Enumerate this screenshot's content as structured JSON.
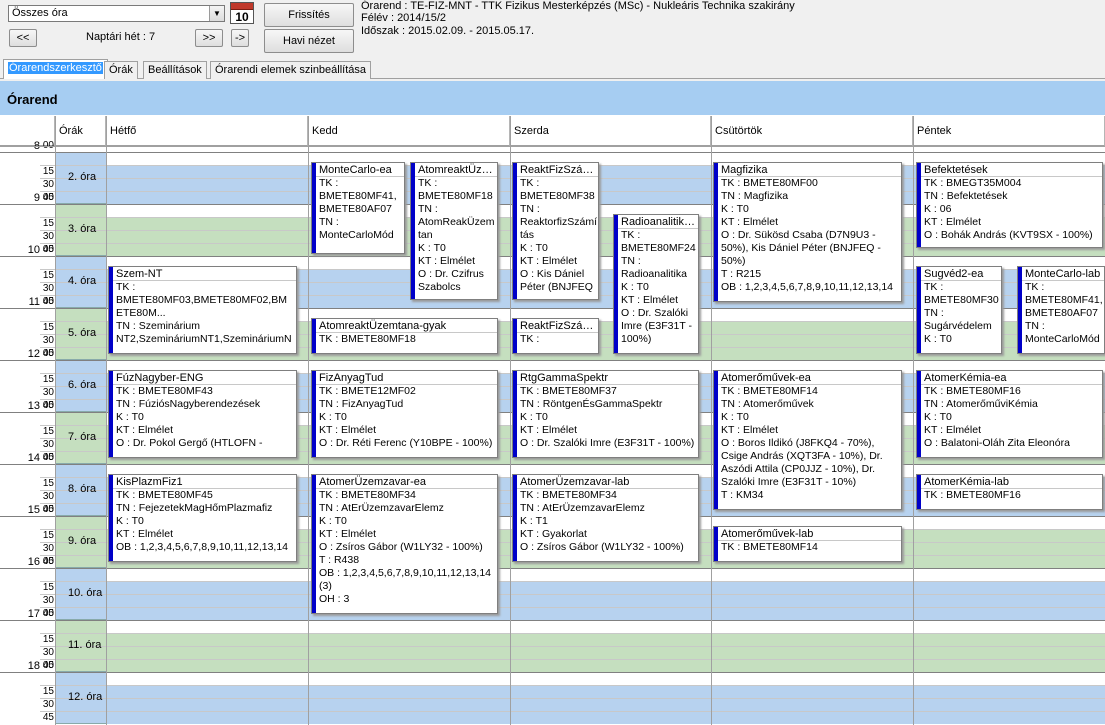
{
  "toolbar": {
    "filter_value": "Összes óra",
    "calendar_icon_number": "10",
    "prev_label": "<<",
    "week_label": "Naptári hét : 7",
    "next_label": ">>",
    "goto_label": "->",
    "refresh_label": "Frissítés",
    "monthly_label": "Havi nézet"
  },
  "info": {
    "timetable": "Órarend : TE-FIZ-MNT - TTK Fizikus Mesterképzés (MSc) - Nukleáris Technika szakirány",
    "semester": "Félév : 2014/15/2",
    "period": "Időszak : 2015.02.09. - 2015.05.17."
  },
  "tabs": [
    {
      "label": "Órarendszerkesztő"
    },
    {
      "label": "Órák"
    },
    {
      "label": "Beállítások"
    },
    {
      "label": "Órarendi elemek szinbeállítása"
    }
  ],
  "timetable": {
    "title": "Órarend",
    "col_hours": "Órák",
    "days": [
      "Hétfő",
      "Kedd",
      "Szerda",
      "Csütörtök",
      "Péntek"
    ],
    "colors": {
      "blue": "#b7d2ef",
      "green": "#c5dfbf",
      "accent": "#0000c8",
      "header": "#a6cdf2"
    },
    "hours": [
      "8",
      "9",
      "10",
      "11",
      "12",
      "13",
      "14",
      "15",
      "16",
      "17",
      "18"
    ],
    "minute_marks": [
      "00",
      "15",
      "30",
      "45"
    ],
    "periods": [
      "2. óra",
      "3. óra",
      "4. óra",
      "5. óra",
      "6. óra",
      "7. óra",
      "8. óra",
      "9. óra",
      "10. óra",
      "11. óra",
      "12. óra"
    ]
  },
  "events": [
    {
      "day": "Kedd",
      "title": "MonteCarlo-ea",
      "body": "TK :\nBMETE80MF41,\nBMETE80AF07\nTN :\nMonteCarloMód"
    },
    {
      "day": "Kedd",
      "title": "AtomreaktÜzem...",
      "body": "TK :\nBMETE80MF18\nTN :\nAtomReakÜzem\ntan\nK : T0\nKT : Elmélet\nO : Dr. Czifrus\nSzabolcs"
    },
    {
      "day": "Szerda",
      "title": "ReaktFizSzám...",
      "body": "TK :\nBMETE80MF38\nTN :\nReaktorfizSzámí\ntás\nK : T0\nKT : Elmélet\nO : Kis Dániel\nPéter (BNJFEQ -"
    },
    {
      "day": "Szerda",
      "title": "Radioanalitika-...",
      "body": "TK :\nBMETE80MF24\nTN :\nRadioanalitika\nK : T0\nKT : Elmélet\nO : Dr. Szalóki\nImre (E3F31T -\n100%)"
    },
    {
      "day": "Csütörtök",
      "title": "Magfizika",
      "body": "TK : BMETE80MF00\nTN : Magfizika\nK : T0\nKT : Elmélet\nO : Dr. Sükösd Csaba (D7N9U3 -\n50%), Kis Dániel Péter (BNJFEQ -\n50%)\nT : R215\nOB : 1,2,3,4,5,6,7,8,9,10,11,12,13,14"
    },
    {
      "day": "Péntek",
      "title": "Befektetések",
      "body": "TK : BMEGT35M004\nTN : Befektetések\nK : 06\nKT : Elmélet\nO : Bohák András (KVT9SX - 100%)"
    },
    {
      "day": "Hétfő",
      "title": "Szem-NT",
      "body": "TK :\nBMETE80MF03,BMETE80MF02,BM\nETE80M...\nTN : Szeminárium\nNT2,SzemináriumNT1,SzemináriumN"
    },
    {
      "day": "Péntek",
      "title": "Sugvéd2-ea",
      "body": "TK :\nBMETE80MF30\nTN :\nSugárvédelem\nK : T0"
    },
    {
      "day": "Péntek",
      "title": "MonteCarlo-lab",
      "body": "TK :\nBMETE80MF41,\nBMETE80AF07\nTN :\nMonteCarloMód"
    },
    {
      "day": "Kedd",
      "title": "AtomreaktÜzemtana-gyak",
      "body": "TK : BMETE80MF18"
    },
    {
      "day": "Szerda",
      "title": "ReaktFizSzám...",
      "body": "TK :"
    },
    {
      "day": "Hétfő",
      "title": "FúzNagyber-ENG",
      "body": "TK : BMETE80MF43\nTN : FúziósNagyberendezések\nK : T0\nKT : Elmélet\nO : Dr. Pokol Gergő (HTLOFN -"
    },
    {
      "day": "Kedd",
      "title": "FizAnyagTud",
      "body": "TK : BMETE12MF02\nTN : FizAnyagTud\nK : T0\nKT : Elmélet\nO : Dr. Réti Ferenc (Y10BPE - 100%)"
    },
    {
      "day": "Szerda",
      "title": "RtgGammaSpektr",
      "body": "TK : BMETE80MF37\nTN : RöntgenÉsGammaSpektr\nK : T0\nKT : Elmélet\nO : Dr. Szalóki Imre (E3F31T - 100%)"
    },
    {
      "day": "Csütörtök",
      "title": "Atomerőművek-ea",
      "body": "TK : BMETE80MF14\nTN : Atomerőművek\nK : T0\nKT : Elmélet\nO : Boros Ildikó (J8FKQ4 - 70%),\nCsige András (XQT3FA - 10%), Dr.\nAszódi Attila (CP0JJZ - 10%), Dr.\nSzalóki Imre (E3F31T - 10%)\nT : KM34"
    },
    {
      "day": "Péntek",
      "title": "AtomerKémia-ea",
      "body": "TK : BMETE80MF16\nTN : AtomerőműviKémia\nK : T0\nKT : Elmélet\nO : Balatoni-Oláh Zita Eleonóra"
    },
    {
      "day": "Hétfő",
      "title": "KisPlazmFiz1",
      "body": "TK : BMETE80MF45\nTN : FejezetekMagHőmPlazmafiz\nK : T0\nKT : Elmélet\nOB : 1,2,3,4,5,6,7,8,9,10,11,12,13,14"
    },
    {
      "day": "Kedd",
      "title": "AtomerÜzemzavar-ea",
      "body": "TK : BMETE80MF34\nTN : AtErÜzemzavarElemz\nK : T0\nKT : Elmélet\nO : Zsíros Gábor (W1LY32 - 100%)\nT : R438\nOB : 1,2,3,4,5,6,7,8,9,10,11,12,13,14\n(3)\nOH : 3"
    },
    {
      "day": "Szerda",
      "title": "AtomerÜzemzavar-lab",
      "body": "TK : BMETE80MF34\nTN : AtErÜzemzavarElemz\nK : T1\nKT : Gyakorlat\nO : Zsíros Gábor (W1LY32 - 100%)"
    },
    {
      "day": "Péntek",
      "title": "AtomerKémia-lab",
      "body": "TK : BMETE80MF16"
    },
    {
      "day": "Csütörtök",
      "title": "Atomerőművek-lab",
      "body": "TK : BMETE80MF14"
    }
  ]
}
